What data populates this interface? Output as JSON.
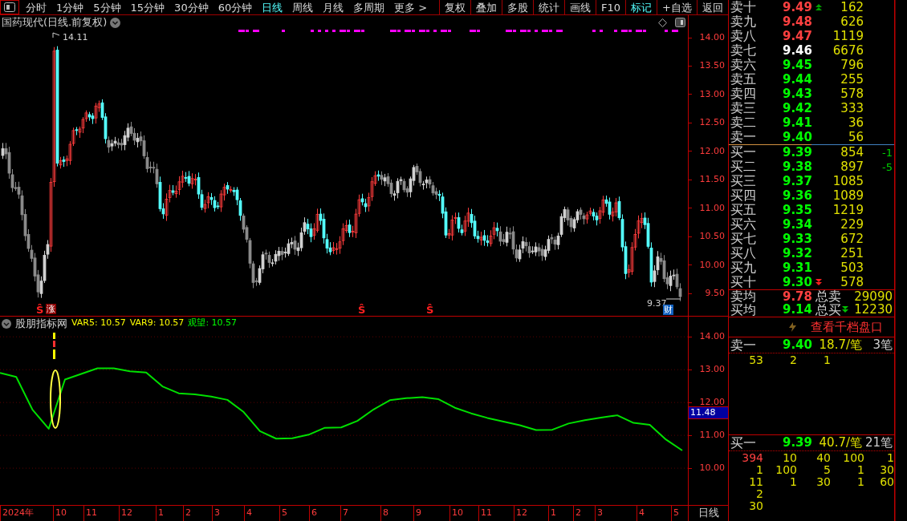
{
  "toolbar": {
    "periods": [
      {
        "label": "分时",
        "selected": false
      },
      {
        "label": "1分钟",
        "selected": false
      },
      {
        "label": "5分钟",
        "selected": false
      },
      {
        "label": "15分钟",
        "selected": false
      },
      {
        "label": "30分钟",
        "selected": false
      },
      {
        "label": "60分钟",
        "selected": false
      },
      {
        "label": "日线",
        "selected": true
      },
      {
        "label": "周线",
        "selected": false
      },
      {
        "label": "月线",
        "selected": false
      },
      {
        "label": "多周期",
        "selected": false
      },
      {
        "label": "更多 >",
        "selected": false
      }
    ],
    "buttons": [
      {
        "label": "复权",
        "selected": false
      },
      {
        "label": "叠加",
        "selected": false
      },
      {
        "label": "多股",
        "selected": false
      },
      {
        "label": "统计",
        "selected": false
      },
      {
        "label": "画线",
        "selected": false
      },
      {
        "label": "F10",
        "selected": false
      },
      {
        "label": "标记",
        "selected": true
      },
      {
        "label": "+自选",
        "selected": false
      },
      {
        "label": "返回",
        "selected": false
      }
    ]
  },
  "chart": {
    "title": "国药现代(日线.前复权)",
    "high_label": "14.11",
    "low_label": "9.37",
    "finance_badge": "财",
    "markers": [
      {
        "kind": "signal",
        "text": "Ŝ"
      },
      {
        "kind": "badge",
        "text": "涨"
      },
      {
        "kind": "signal",
        "text": "Ŝ"
      },
      {
        "kind": "signal",
        "text": "Ŝ"
      }
    ]
  },
  "price_axis": [
    "14.00",
    "13.50",
    "13.00",
    "12.50",
    "12.00",
    "11.50",
    "11.00",
    "10.50",
    "10.00",
    "9.50"
  ],
  "indicator": {
    "name": "股朋指标网",
    "values": [
      {
        "text": "VAR5: 10.57",
        "color": "#ffff00"
      },
      {
        "text": "VAR9: 10.57",
        "color": "#ffff00"
      },
      {
        "text": "观望: 10.57",
        "color": "#00ff00"
      }
    ],
    "chart_data": {
      "type": "line",
      "ylim": [
        8.88,
        14.2
      ],
      "grid": true,
      "yticks": [
        {
          "value": 14,
          "label": "14.00"
        },
        {
          "value": 13,
          "label": "13.00"
        },
        {
          "value": 12,
          "label": "12.00"
        },
        {
          "value": 11,
          "label": "11.00"
        },
        {
          "value": 10,
          "label": "10.00"
        }
      ],
      "series": [
        {
          "color": "#00e000",
          "values": [
            12.9,
            12.78,
            11.78,
            11.2,
            12.7,
            12.87,
            13.04,
            13.04,
            12.95,
            12.91,
            12.49,
            12.28,
            12.25,
            12.18,
            12.08,
            11.71,
            11.13,
            10.9,
            10.91,
            11.02,
            11.23,
            11.24,
            11.44,
            11.79,
            12.07,
            12.13,
            12.16,
            12.1,
            11.84,
            11.67,
            11.53,
            11.42,
            11.31,
            11.16,
            11.17,
            11.36,
            11.46,
            11.54,
            11.61,
            11.38,
            11.32,
            10.87,
            10.54
          ]
        }
      ]
    }
  },
  "indicator_current": "11.48",
  "time_axis": {
    "labels": [
      "2024年",
      "10",
      "11",
      "12",
      "1",
      "2",
      "3",
      "4",
      "5",
      "6",
      "7",
      "8",
      "9",
      "10",
      "11",
      "12",
      "1",
      "2",
      "3",
      "4",
      "5"
    ],
    "period": "日线"
  },
  "order_book": {
    "asks": [
      {
        "label": "卖十",
        "price": "9.49",
        "volume": "162",
        "color": "#ff4040",
        "arrow": true
      },
      {
        "label": "卖九",
        "price": "9.48",
        "volume": "626",
        "color": "#ff4040",
        "arrow": false
      },
      {
        "label": "卖八",
        "price": "9.47",
        "volume": "1119",
        "color": "#ff4040",
        "arrow": false
      },
      {
        "label": "卖七",
        "price": "9.46",
        "volume": "6676",
        "color": "#ffffff",
        "arrow": false
      },
      {
        "label": "卖六",
        "price": "9.45",
        "volume": "796",
        "color": "#00ff00",
        "arrow": false
      },
      {
        "label": "卖五",
        "price": "9.44",
        "volume": "255",
        "color": "#00ff00",
        "arrow": false
      },
      {
        "label": "卖四",
        "price": "9.43",
        "volume": "578",
        "color": "#00ff00",
        "arrow": false
      },
      {
        "label": "卖三",
        "price": "9.42",
        "volume": "333",
        "color": "#00ff00",
        "arrow": false
      },
      {
        "label": "卖二",
        "price": "9.41",
        "volume": "36",
        "color": "#00ff00",
        "arrow": false
      },
      {
        "label": "卖一",
        "price": "9.40",
        "volume": "56",
        "color": "#00ff00",
        "arrow": false
      }
    ],
    "bids": [
      {
        "label": "买一",
        "price": "9.39",
        "volume": "854",
        "change": "-1",
        "color": "#00ff00",
        "arrow": false
      },
      {
        "label": "买二",
        "price": "9.38",
        "volume": "897",
        "change": "-5",
        "color": "#00ff00",
        "arrow": false
      },
      {
        "label": "买三",
        "price": "9.37",
        "volume": "1085",
        "color": "#00ff00",
        "arrow": false
      },
      {
        "label": "买四",
        "price": "9.36",
        "volume": "1089",
        "color": "#00ff00",
        "arrow": false
      },
      {
        "label": "买五",
        "price": "9.35",
        "volume": "1219",
        "color": "#00ff00",
        "arrow": false
      },
      {
        "label": "买六",
        "price": "9.34",
        "volume": "229",
        "color": "#00ff00",
        "arrow": false
      },
      {
        "label": "买七",
        "price": "9.33",
        "volume": "672",
        "color": "#00ff00",
        "arrow": false
      },
      {
        "label": "买八",
        "price": "9.32",
        "volume": "251",
        "color": "#00ff00",
        "arrow": false
      },
      {
        "label": "买九",
        "price": "9.31",
        "volume": "503",
        "color": "#00ff00",
        "arrow": false
      },
      {
        "label": "买十",
        "price": "9.30",
        "volume": "578",
        "color": "#00ff00",
        "arrow": true
      }
    ],
    "summary": [
      {
        "label": "卖均",
        "price": "9.78",
        "color": "#ff4040",
        "total_label": "总卖",
        "total": "29090",
        "arrow": false
      },
      {
        "label": "买均",
        "price": "9.14",
        "color": "#00ff00",
        "total_label": "总买",
        "total": "12230",
        "arrow": true
      }
    ]
  },
  "depth": {
    "link": "查看千档盘口",
    "sell": {
      "label": "卖一",
      "price": "9.40",
      "avg": "18.7/笔",
      "count": "3笔",
      "orders": [
        [
          "53",
          "2",
          "1"
        ]
      ]
    },
    "buy": {
      "label": "买一",
      "price": "9.39",
      "avg": "40.7/笔",
      "count": "21笔",
      "first_order_large": true,
      "orders": [
        [
          "394",
          "10",
          "40",
          "100",
          "1"
        ],
        [
          "1",
          "100",
          "5",
          "1",
          "30"
        ],
        [
          "11",
          "1",
          "30",
          "1",
          "60"
        ],
        [
          "2"
        ],
        [
          "30"
        ]
      ]
    }
  }
}
